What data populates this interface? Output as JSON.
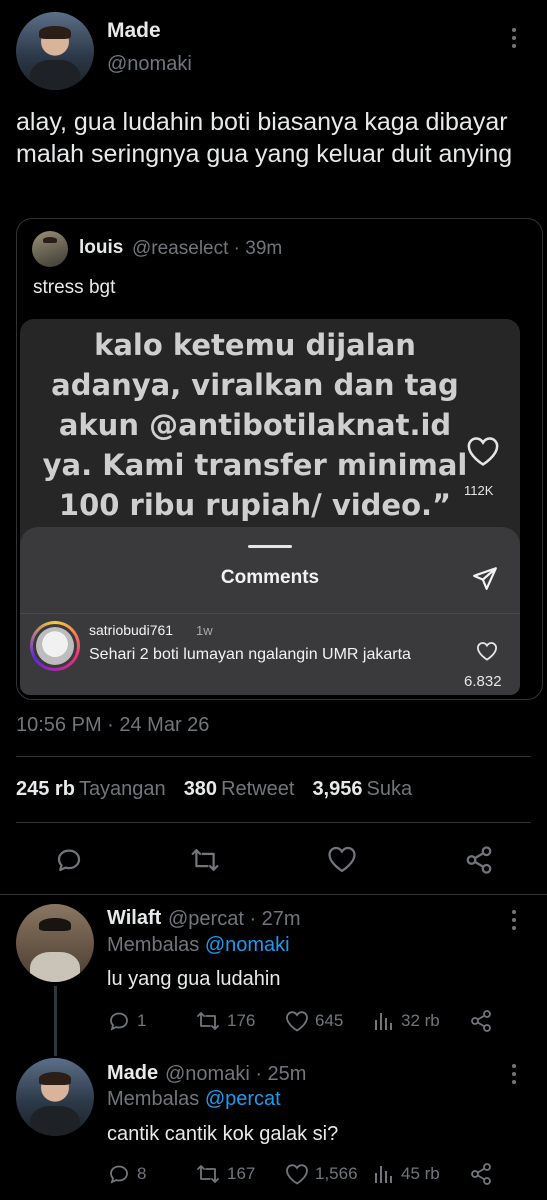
{
  "main_tweet": {
    "display_name": "Made",
    "handle": "@nomaki",
    "text": "alay, gua ludahin boti biasanya kaga dibayar malah seringnya gua yang keluar duit anying",
    "timestamp": "10:56 PM · 24 Mar 26",
    "stats": {
      "views_count": "245 rb",
      "views_label": "Tayangan",
      "retweets_count": "380",
      "retweets_label": "Retweet",
      "likes_count": "3,956",
      "likes_label": "Suka"
    }
  },
  "quoted_tweet": {
    "display_name": "louis",
    "handle_time": "@reaselect · 39m",
    "text": "stress bgt",
    "media": {
      "overlay_text_lines": [
        "kalo ketemu dijalan",
        "adanya, viralkan dan tag",
        "akun @antibotilaknat.id",
        "ya. Kami transfer minimal",
        "100 ribu rupiah/ video.”"
      ],
      "side_like_count": "112K",
      "comments_title": "Comments",
      "comment": {
        "username": "satriobudi761",
        "age": "1w",
        "text": "Sehari 2 boti lumayan ngalangin UMR jakarta",
        "likes": "6.832"
      }
    }
  },
  "replies": [
    {
      "display_name": "Wilaft",
      "handle_time": "@percat · 27m",
      "replying_prefix": "Membalas",
      "replying_to": "@nomaki",
      "text": "lu yang gua ludahin",
      "replies": "1",
      "retweets": "176",
      "likes": "645",
      "views": "32 rb"
    },
    {
      "display_name": "Made",
      "handle_time": "@nomaki · 25m",
      "replying_prefix": "Membalas",
      "replying_to": "@percat",
      "text": "cantik cantik kok galak si?",
      "replies": "8",
      "retweets": "167",
      "likes": "1,566",
      "views": "45 rb"
    }
  ],
  "colors": {
    "background": "#000000",
    "text": "#e7e9ea",
    "muted": "#71767b",
    "accent": "#1d9bf0",
    "divider": "#2f3336"
  }
}
